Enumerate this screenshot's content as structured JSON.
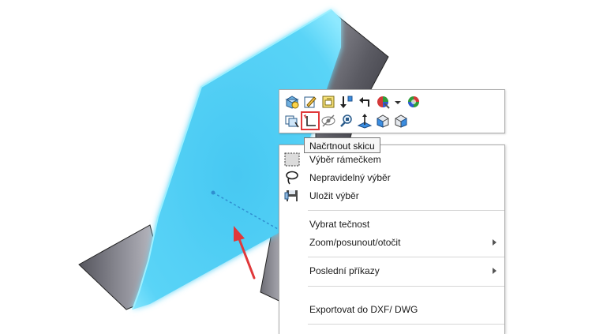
{
  "tooltip": {
    "text": "Načrtnout skicu"
  },
  "toolbar": {
    "row1": [
      {
        "name": "zoom-to-fit-icon"
      },
      {
        "name": "edit-sketch-icon"
      },
      {
        "name": "edit-feature-icon"
      },
      {
        "name": "rollback-icon"
      },
      {
        "name": "parent-child-icon"
      },
      {
        "name": "appearance-icon"
      },
      {
        "name": "appearance-dropdown-icon"
      },
      {
        "name": "display-style-icon"
      }
    ],
    "row2": [
      {
        "name": "copy-selection-icon"
      },
      {
        "name": "sketch-icon"
      },
      {
        "name": "hide-icon"
      },
      {
        "name": "zoom-to-selection-icon"
      },
      {
        "name": "normal-to-icon"
      },
      {
        "name": "view-orientation-icon"
      },
      {
        "name": "view-settings-icon"
      }
    ]
  },
  "menu": {
    "items": [
      {
        "key": "box_select",
        "label": "Výběr rámečkem",
        "icon": "box-select-icon"
      },
      {
        "key": "lasso_select",
        "label": "Nepravidelný výběr",
        "icon": "lasso-icon"
      },
      {
        "key": "save_selection",
        "label": "Uložit výběr",
        "icon": "save-icon"
      },
      {
        "key": "select_tangency",
        "label": "Vybrat tečnost"
      },
      {
        "key": "zoom_pan_rotate",
        "label": "Zoom/posunout/otočit",
        "submenu": true
      },
      {
        "key": "recent_commands",
        "label": "Poslední příkazy",
        "submenu": true
      },
      {
        "key": "export_dxf",
        "label": "Exportovat  do DXF/ DWG"
      }
    ]
  },
  "colors": {
    "face_highlight": "#5fd3f5",
    "face_glow": "#8ee6ff",
    "metal_dark": "#4a4a52",
    "arrow_red": "#e0383a"
  }
}
